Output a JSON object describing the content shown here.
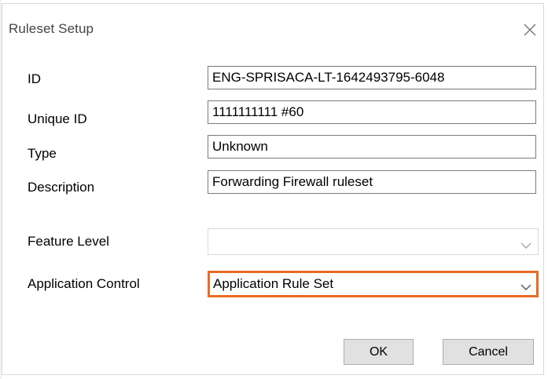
{
  "dialog": {
    "title": "Ruleset Setup",
    "close_icon": "close-icon"
  },
  "fields": [
    {
      "label": "ID",
      "value": "ENG-SPRISACA-LT-1642493795-6048"
    },
    {
      "label": "Unique ID",
      "value": "1111111111 #60"
    },
    {
      "label": "Type",
      "value": "Unknown"
    },
    {
      "label": "Description",
      "value": "Forwarding Firewall ruleset"
    }
  ],
  "feature_level": {
    "label": "Feature Level",
    "value": "",
    "enabled": false
  },
  "application_control": {
    "label": "Application Control",
    "value": "Application Rule Set",
    "highlight_color": "#e86a24"
  },
  "buttons": {
    "ok": "OK",
    "cancel": "Cancel"
  }
}
